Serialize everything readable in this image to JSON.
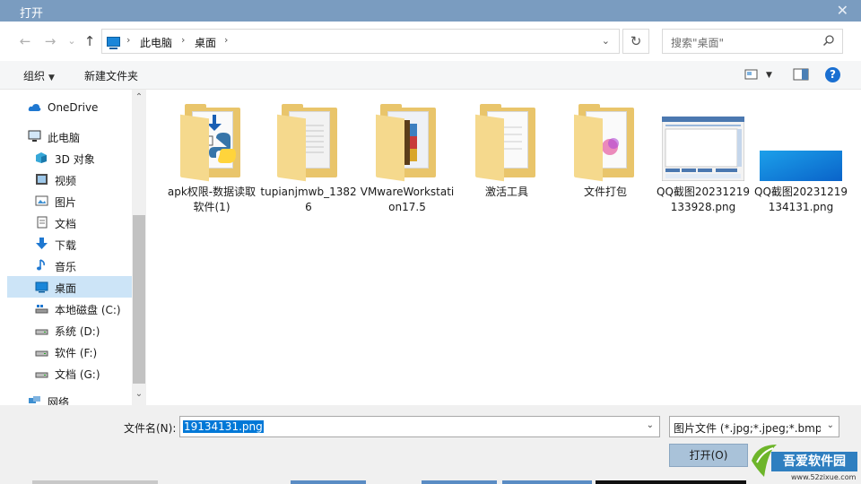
{
  "window": {
    "title": "打开",
    "close_glyph": "✕"
  },
  "address": {
    "crumbs": [
      "此电脑",
      "桌面"
    ],
    "search_placeholder": "搜索\"桌面\""
  },
  "toolbar": {
    "organize_label": "组织",
    "new_folder_label": "新建文件夹",
    "help_glyph": "?"
  },
  "sidebar": {
    "items": [
      {
        "label": "OneDrive",
        "icon": "cloud-icon"
      },
      {
        "label": "此电脑",
        "icon": "computer-icon"
      },
      {
        "label": "3D 对象",
        "icon": "cube-icon"
      },
      {
        "label": "视频",
        "icon": "video-icon"
      },
      {
        "label": "图片",
        "icon": "picture-icon"
      },
      {
        "label": "文档",
        "icon": "document-icon"
      },
      {
        "label": "下载",
        "icon": "download-icon"
      },
      {
        "label": "音乐",
        "icon": "music-icon"
      },
      {
        "label": "桌面",
        "icon": "desktop-icon",
        "selected": true
      },
      {
        "label": "本地磁盘 (C:)",
        "icon": "drive-icon"
      },
      {
        "label": "系统 (D:)",
        "icon": "drive-icon"
      },
      {
        "label": "软件 (F:)",
        "icon": "drive-icon"
      },
      {
        "label": "文档 (G:)",
        "icon": "drive-icon"
      },
      {
        "label": "网络",
        "icon": "network-icon"
      }
    ]
  },
  "files": [
    {
      "name": "apk权限-数据读取软件(1)",
      "type": "folder",
      "icon": "python-folder-icon"
    },
    {
      "name": "tupianjmwb_13826",
      "type": "folder",
      "icon": "folder-icon"
    },
    {
      "name": "VMwareWorkstation17.5",
      "type": "folder",
      "icon": "winrar-folder-icon"
    },
    {
      "name": "激活工具",
      "type": "folder",
      "icon": "folder-icon"
    },
    {
      "name": "文件打包",
      "type": "folder",
      "icon": "folder-icon"
    },
    {
      "name": "QQ截图20231219133928.png",
      "type": "image",
      "icon": "screenshot-thumbnail"
    },
    {
      "name": "QQ截图20231219134131.png",
      "type": "image",
      "icon": "wallpaper-thumbnail"
    }
  ],
  "footer": {
    "filename_label": "文件名(N):",
    "filename_value": "19134131.png",
    "filter_value": "图片文件 (*.jpg;*.jpeg;*.bmp;*",
    "open_label": "打开(O)"
  },
  "watermark": {
    "text": "吾爱软件园",
    "url": "www.52zixue.com"
  },
  "colors": {
    "titlebar": "#7a9cc0",
    "selection": "#cce4f7",
    "accent": "#0078d7",
    "folder": "#e9c56b"
  }
}
